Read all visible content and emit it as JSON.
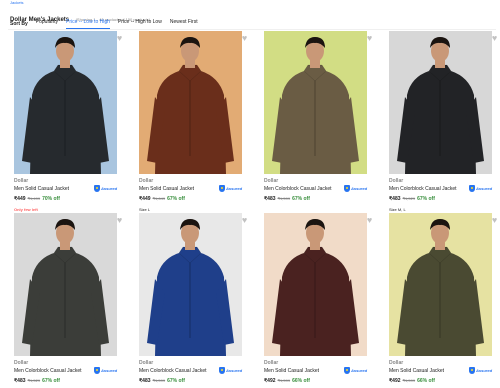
{
  "breadcrumb": "Jackets",
  "heading": {
    "title": "Dollar Men's Jackets",
    "count": "(Showing 1 - 40 products of 150 products)"
  },
  "sort": {
    "label": "Sort By",
    "options": [
      "Popularity",
      "Price -- Low to High",
      "Price -- High to Low",
      "Newest First"
    ],
    "active_index": 1
  },
  "colors": {
    "accent": "#2874f0",
    "discount": "#388e3c",
    "few_left": "#ff6161"
  },
  "products": [
    {
      "brand": "Dollar",
      "name": "Men Solid Casual Jacket",
      "price": "₹449",
      "mrp": "₹1,499",
      "off": "70% off",
      "note": "Only few left",
      "assured": "Assured",
      "bg": "#a9c5df",
      "jacket": "#262a2e",
      "icon": "heart-icon"
    },
    {
      "brand": "Dollar",
      "name": "Men Solid Casual Jacket",
      "price": "₹449",
      "mrp": "₹1,649",
      "off": "67% off",
      "note": "Size L",
      "assured": "Assured",
      "bg": "#e2ab74",
      "jacket": "#6a2e1b",
      "icon": "heart-icon"
    },
    {
      "brand": "Dollar",
      "name": "Men Colorblock Casual Jacket",
      "price": "₹483",
      "mrp": "₹1,599",
      "off": "67% off",
      "note": "",
      "assured": "Assured",
      "bg": "#d2dd84",
      "jacket": "#6a5c44",
      "icon": "heart-icon"
    },
    {
      "brand": "Dollar",
      "name": "Men Colorblock Casual Jacket",
      "price": "₹483",
      "mrp": "₹1,529",
      "off": "67% off",
      "note": "Size M, L",
      "assured": "Assured",
      "bg": "#d7d7d7",
      "jacket": "#222326",
      "icon": "heart-icon"
    },
    {
      "brand": "Dollar",
      "name": "Men Colorblock Casual Jacket",
      "price": "₹483",
      "mrp": "₹1,529",
      "off": "67% off",
      "note": "",
      "assured": "Assured",
      "bg": "#d9d9d9",
      "jacket": "#3b3d39",
      "icon": "heart-icon"
    },
    {
      "brand": "Dollar",
      "name": "Men Colorblock Casual Jacket",
      "price": "₹483",
      "mrp": "₹1,599",
      "off": "67% off",
      "note": "",
      "assured": "Assured",
      "bg": "#e8e8e8",
      "jacket": "#1f3f8a",
      "icon": "heart-icon"
    },
    {
      "brand": "Dollar",
      "name": "Men Solid Casual Jacket",
      "price": "₹492",
      "mrp": "₹1,599",
      "off": "66% off",
      "note": "",
      "assured": "Assured",
      "bg": "#f1dbc8",
      "jacket": "#4a2220",
      "icon": "heart-icon"
    },
    {
      "brand": "Dollar",
      "name": "Men Solid Casual Jacket",
      "price": "₹492",
      "mrp": "₹1,599",
      "off": "66% off",
      "note": "",
      "assured": "Assured",
      "bg": "#e6e2a2",
      "jacket": "#4a4a32",
      "icon": "heart-icon"
    }
  ]
}
